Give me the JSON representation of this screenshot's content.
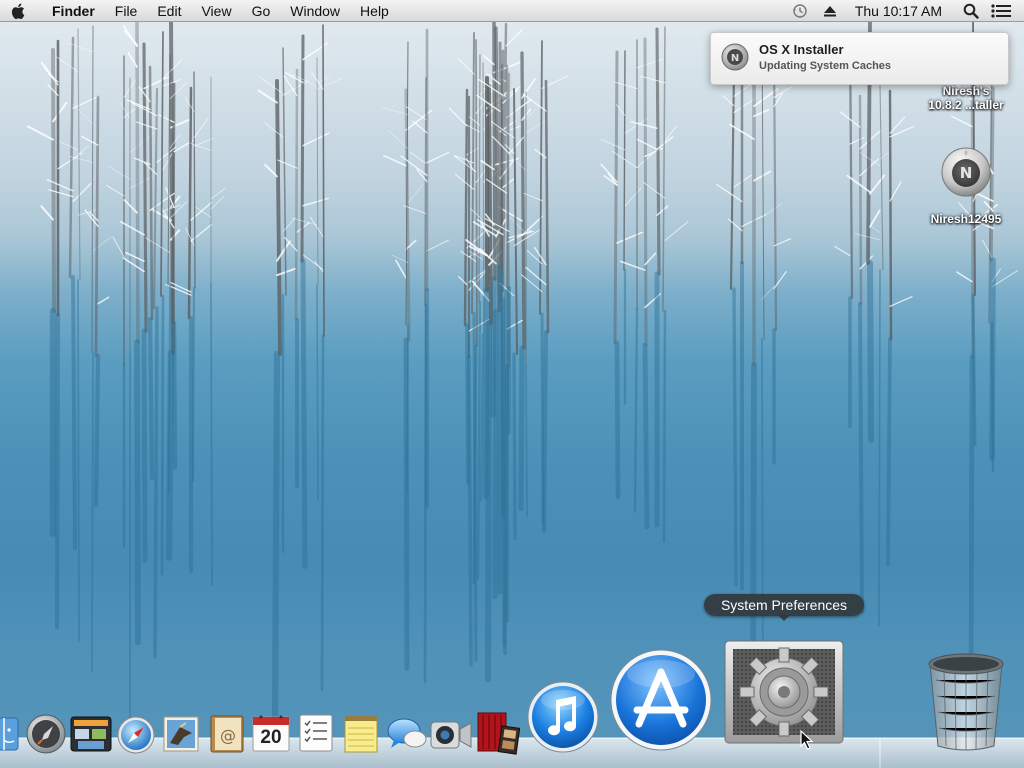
{
  "menubar": {
    "app_name": "Finder",
    "menus": [
      "File",
      "Edit",
      "View",
      "Go",
      "Window",
      "Help"
    ],
    "clock": "Thu 10:17 AM",
    "status_icons": [
      "time-machine-icon",
      "eject-icon",
      "spotlight-icon",
      "notification-center-icon"
    ]
  },
  "notification": {
    "title": "OS X Installer",
    "body": "Updating System Caches",
    "icon": "installer-icon"
  },
  "desktop": {
    "icons": [
      {
        "label_line1": "Niresh's",
        "label_line2": "10.8.2 ...taller",
        "icon": "disk-icon"
      },
      {
        "label": "Niresh12495",
        "icon": "disk-icon"
      }
    ]
  },
  "dock": {
    "tooltip": "System Preferences",
    "calendar_day": "20",
    "items": [
      "finder-icon",
      "launchpad-icon",
      "mission-control-icon",
      "safari-icon",
      "mail-icon",
      "contacts-icon",
      "calendar-icon",
      "reminders-icon",
      "notes-icon",
      "messages-icon",
      "facetime-icon",
      "photo-booth-icon",
      "itunes-icon",
      "app-store-icon",
      "system-preferences-icon",
      "trash-icon"
    ]
  },
  "colors": {
    "menubar": "#e8e8e8",
    "tooltip": "#32373c",
    "wallpaper_water": "#4f93ba"
  }
}
